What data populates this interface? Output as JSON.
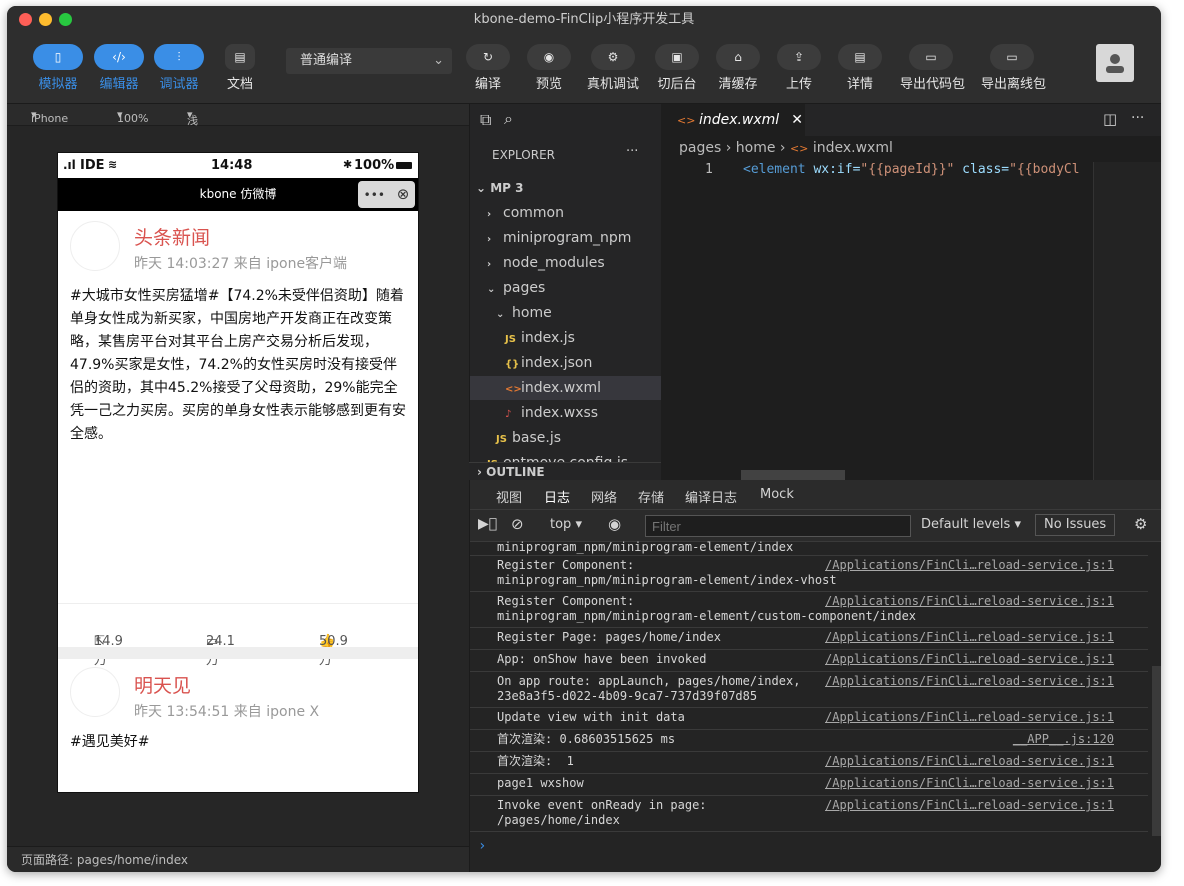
{
  "window": {
    "title": "kbone-demo-FinClip小程序开发工具"
  },
  "toolbar": {
    "simulator": "模拟器",
    "editor": "编辑器",
    "debugger": "调试器",
    "docs": "文档",
    "compile_mode": "普通编译",
    "compile": "编译",
    "preview": "预览",
    "real_debug": "真机调试",
    "background": "切后台",
    "clear_cache": "清缓存",
    "upload": "上传",
    "details": "详情",
    "export_code": "导出代码包",
    "export_offline": "导出离线包"
  },
  "simbar": {
    "device": "iPhone 5",
    "zoom": "100%",
    "theme": "浅色"
  },
  "phone": {
    "status_left": "IDE",
    "status_time": "14:48",
    "status_battery": "100%",
    "nav_title": "kbone 仿微博",
    "capsule_more": "•••",
    "capsule_close": "⊗",
    "post1": {
      "name": "头条新闻",
      "time": "昨天 14:03:27 来自 ipone客户端",
      "text": "#大城市女性买房猛增#【74.2%未受伴侣资助】随着单身女性成为新买家，中国房地产开发商正在改变策略，某售房平台对其平台上房产交易分析后发现，47.9%买家是女性，74.2%的女性买房时没有接受伴侣的资助，其中45.2%接受了父母资助，29%能完全凭一己之力买房。买房的单身女性表示能够感到更有安全感。",
      "share": "14.9万",
      "comment": "24.1万",
      "like": "50.9万"
    },
    "post2": {
      "name": "明天见",
      "time": "昨天 13:54:51 来自 ipone X",
      "text": "#遇见美好#"
    }
  },
  "path_bar": "页面路径: pages/home/index",
  "explorer": {
    "header": "EXPLORER",
    "project": "MP 3",
    "items": [
      {
        "label": "common",
        "icon": "›",
        "indent": 1
      },
      {
        "label": "miniprogram_npm",
        "icon": "›",
        "indent": 1
      },
      {
        "label": "node_modules",
        "icon": "›",
        "indent": 1
      },
      {
        "label": "pages",
        "icon": "⌄",
        "indent": 1
      },
      {
        "label": "home",
        "icon": "⌄",
        "indent": 2
      },
      {
        "label": "index.js",
        "icon": "JS",
        "indent": 3
      },
      {
        "label": "index.json",
        "icon": "{}",
        "indent": 3
      },
      {
        "label": "index.wxml",
        "icon": "<>",
        "indent": 3
      },
      {
        "label": "index.wxss",
        "icon": "♪",
        "indent": 3
      },
      {
        "label": "base.js",
        "icon": "JS",
        "indent": 2
      },
      {
        "label": "entmove.config.js",
        "icon": "JS",
        "indent": 1
      }
    ],
    "outline": "OUTLINE"
  },
  "editor": {
    "tab": "index.wxml",
    "crumb_pages": "pages",
    "crumb_home": "home",
    "crumb_file": "index.wxml",
    "line_no": "1",
    "code_tag": "<element",
    "code_attr1": "wx:if=",
    "code_val1": "\"{{pageId}}\"",
    "code_attr2": "class=",
    "code_val2": "\"{{bodyCl"
  },
  "devtools": {
    "tabs": [
      "视图",
      "日志",
      "网络",
      "存储",
      "编译日志",
      "Mock"
    ],
    "context": "top",
    "filter_placeholder": "Filter",
    "levels": "Default levels",
    "issues": "No Issues",
    "logs": [
      {
        "msg": "miniprogram_npm/miniprogram-element/index",
        "src": ""
      },
      {
        "msg": "Register Component:\nminiprogram_npm/miniprogram-element/index-vhost",
        "src": "/Applications/FinCli…reload-service.js:1"
      },
      {
        "msg": "Register Component:\nminiprogram_npm/miniprogram-element/custom-component/index",
        "src": "/Applications/FinCli…reload-service.js:1"
      },
      {
        "msg": "Register Page: pages/home/index",
        "src": "/Applications/FinCli…reload-service.js:1"
      },
      {
        "msg": "App: onShow have been invoked",
        "src": "/Applications/FinCli…reload-service.js:1"
      },
      {
        "msg": "On app route: appLaunch, pages/home/index,\n23e8a3f5-d022-4b09-9ca7-737d39f07d85",
        "src": "/Applications/FinCli…reload-service.js:1"
      },
      {
        "msg": "Update view with init data",
        "src": "/Applications/FinCli…reload-service.js:1"
      },
      {
        "msg": "首次渲染: 0.68603515625 ms",
        "src": "__APP__.js:120"
      },
      {
        "msg": "首次渲染:  1",
        "src": "/Applications/FinCli…reload-service.js:1"
      },
      {
        "msg": "page1 wxshow",
        "src": "/Applications/FinCli…reload-service.js:1"
      },
      {
        "msg": "Invoke event onReady in page:\n/pages/home/index",
        "src": "/Applications/FinCli…reload-service.js:1"
      }
    ],
    "prompt": "›"
  },
  "colors": {
    "accent": "#3a8ee6",
    "post_name": "#d9534f",
    "code_tag": "#569cd6",
    "code_attr": "#9cdcfe",
    "code_val": "#ce9178"
  }
}
